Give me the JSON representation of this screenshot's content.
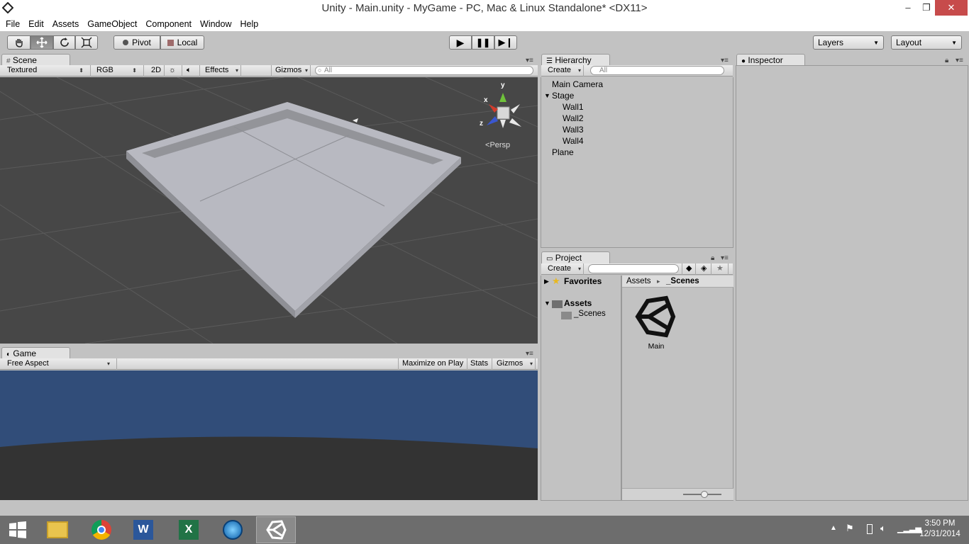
{
  "window": {
    "title": "Unity - Main.unity - MyGame - PC, Mac & Linux Standalone* <DX11>",
    "minimize": "–",
    "maximize": "❐",
    "close": "✕"
  },
  "menu": [
    "File",
    "Edit",
    "Assets",
    "GameObject",
    "Component",
    "Window",
    "Help"
  ],
  "toolbar": {
    "pivot": "Pivot",
    "local": "Local",
    "layers": "Layers",
    "layout": "Layout"
  },
  "scene": {
    "tab": "Scene",
    "shading": "Textured",
    "rgb": "RGB",
    "mode2d": "2D",
    "effects": "Effects",
    "gizmos": "Gizmos",
    "search_placeholder": "All",
    "persp": "Persp",
    "axis_x": "x",
    "axis_y": "y",
    "axis_z": "z"
  },
  "game": {
    "tab": "Game",
    "aspect": "Free Aspect",
    "maximize": "Maximize on Play",
    "stats": "Stats",
    "gizmos": "Gizmos"
  },
  "hierarchy": {
    "tab": "Hierarchy",
    "create": "Create",
    "search_placeholder": "All",
    "items": [
      "Main Camera",
      "Stage",
      "Wall1",
      "Wall2",
      "Wall3",
      "Wall4",
      "Plane"
    ]
  },
  "project": {
    "tab": "Project",
    "create": "Create",
    "favorites": "Favorites",
    "assets": "Assets",
    "scenes_folder": "_Scenes",
    "breadcrumb_root": "Assets",
    "breadcrumb_sep": "▸",
    "breadcrumb_current": "_Scenes",
    "asset_label": "Main"
  },
  "inspector": {
    "tab": "Inspector"
  },
  "taskbar": {
    "time": "3:50 PM",
    "date": "12/31/2014"
  },
  "colors": {
    "scene_bg": "#474747",
    "game_sky": "#314d79",
    "game_ground": "#333333",
    "taskbar": "#6d6d6d"
  }
}
